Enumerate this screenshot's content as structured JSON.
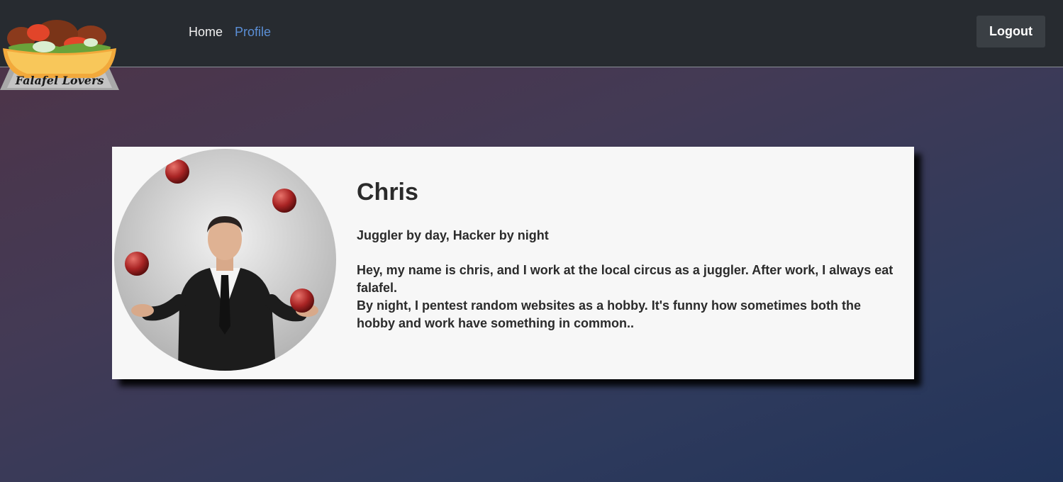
{
  "logo": {
    "text": "Falafel Lovers",
    "icon": "falafel-bowl-logo"
  },
  "nav": {
    "home_label": "Home",
    "profile_label": "Profile",
    "logout_label": "Logout"
  },
  "profile": {
    "name": "Chris",
    "tagline": "Juggler by day, Hacker by night",
    "bio_lines": [
      "Hey, my name is chris, and I work at the local circus as a juggler. After work, I always eat falafel.",
      "By night, I pentest random websites as a hobby. It's funny how sometimes both the hobby and work have something in common.."
    ],
    "avatar_alt": "juggler-photo"
  },
  "colors": {
    "navbar": "#272b30",
    "active_link": "#5b8fd6",
    "card": "#f7f7f7",
    "logout_button": "#3a3f44"
  }
}
